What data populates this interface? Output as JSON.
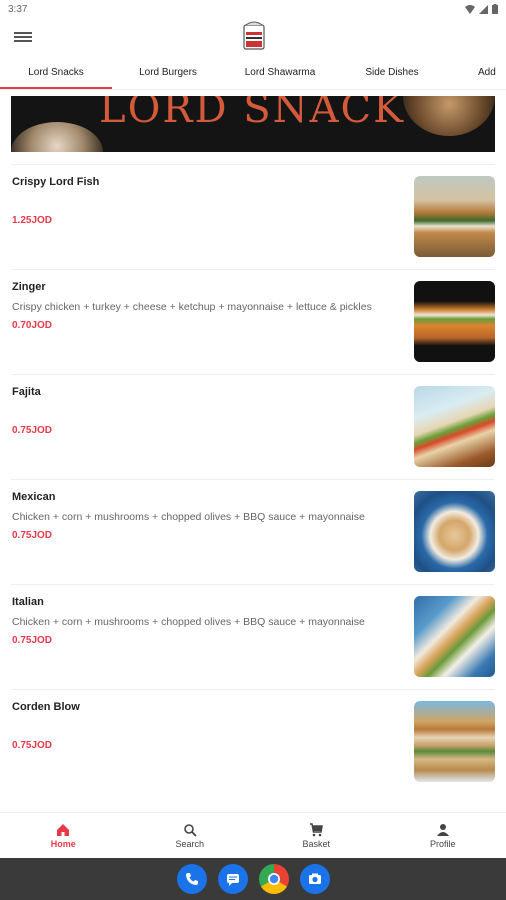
{
  "status": {
    "time": "3:37"
  },
  "tabs": [
    "Lord Snacks",
    "Lord Burgers",
    "Lord Shawarma",
    "Side Dishes",
    "Add"
  ],
  "banner": {
    "text": "LORD SNACK"
  },
  "items": [
    {
      "name": "Crispy Lord Fish",
      "description": "",
      "price": "1.25JOD"
    },
    {
      "name": "Zinger",
      "description": "Crispy chicken + turkey + cheese + ketchup + mayonnaise + lettuce & pickles",
      "price": "0.70JOD"
    },
    {
      "name": "Fajita",
      "description": "",
      "price": "0.75JOD"
    },
    {
      "name": "Mexican",
      "description": "Chicken + corn + mushrooms + chopped olives + BBQ sauce + mayonnaise",
      "price": "0.75JOD"
    },
    {
      "name": "Italian",
      "description": "Chicken + corn + mushrooms + chopped olives + BBQ sauce + mayonnaise",
      "price": "0.75JOD"
    },
    {
      "name": "Corden Blow",
      "description": "",
      "price": "0.75JOD"
    }
  ],
  "bottom_nav": [
    {
      "label": "Home",
      "icon": "home-icon"
    },
    {
      "label": "Search",
      "icon": "search-icon"
    },
    {
      "label": "Basket",
      "icon": "cart-icon"
    },
    {
      "label": "Profile",
      "icon": "person-icon"
    }
  ],
  "dock": [
    "phone-icon",
    "messages-icon",
    "chrome-icon",
    "camera-icon"
  ],
  "colors": {
    "accent": "#e8394a"
  }
}
